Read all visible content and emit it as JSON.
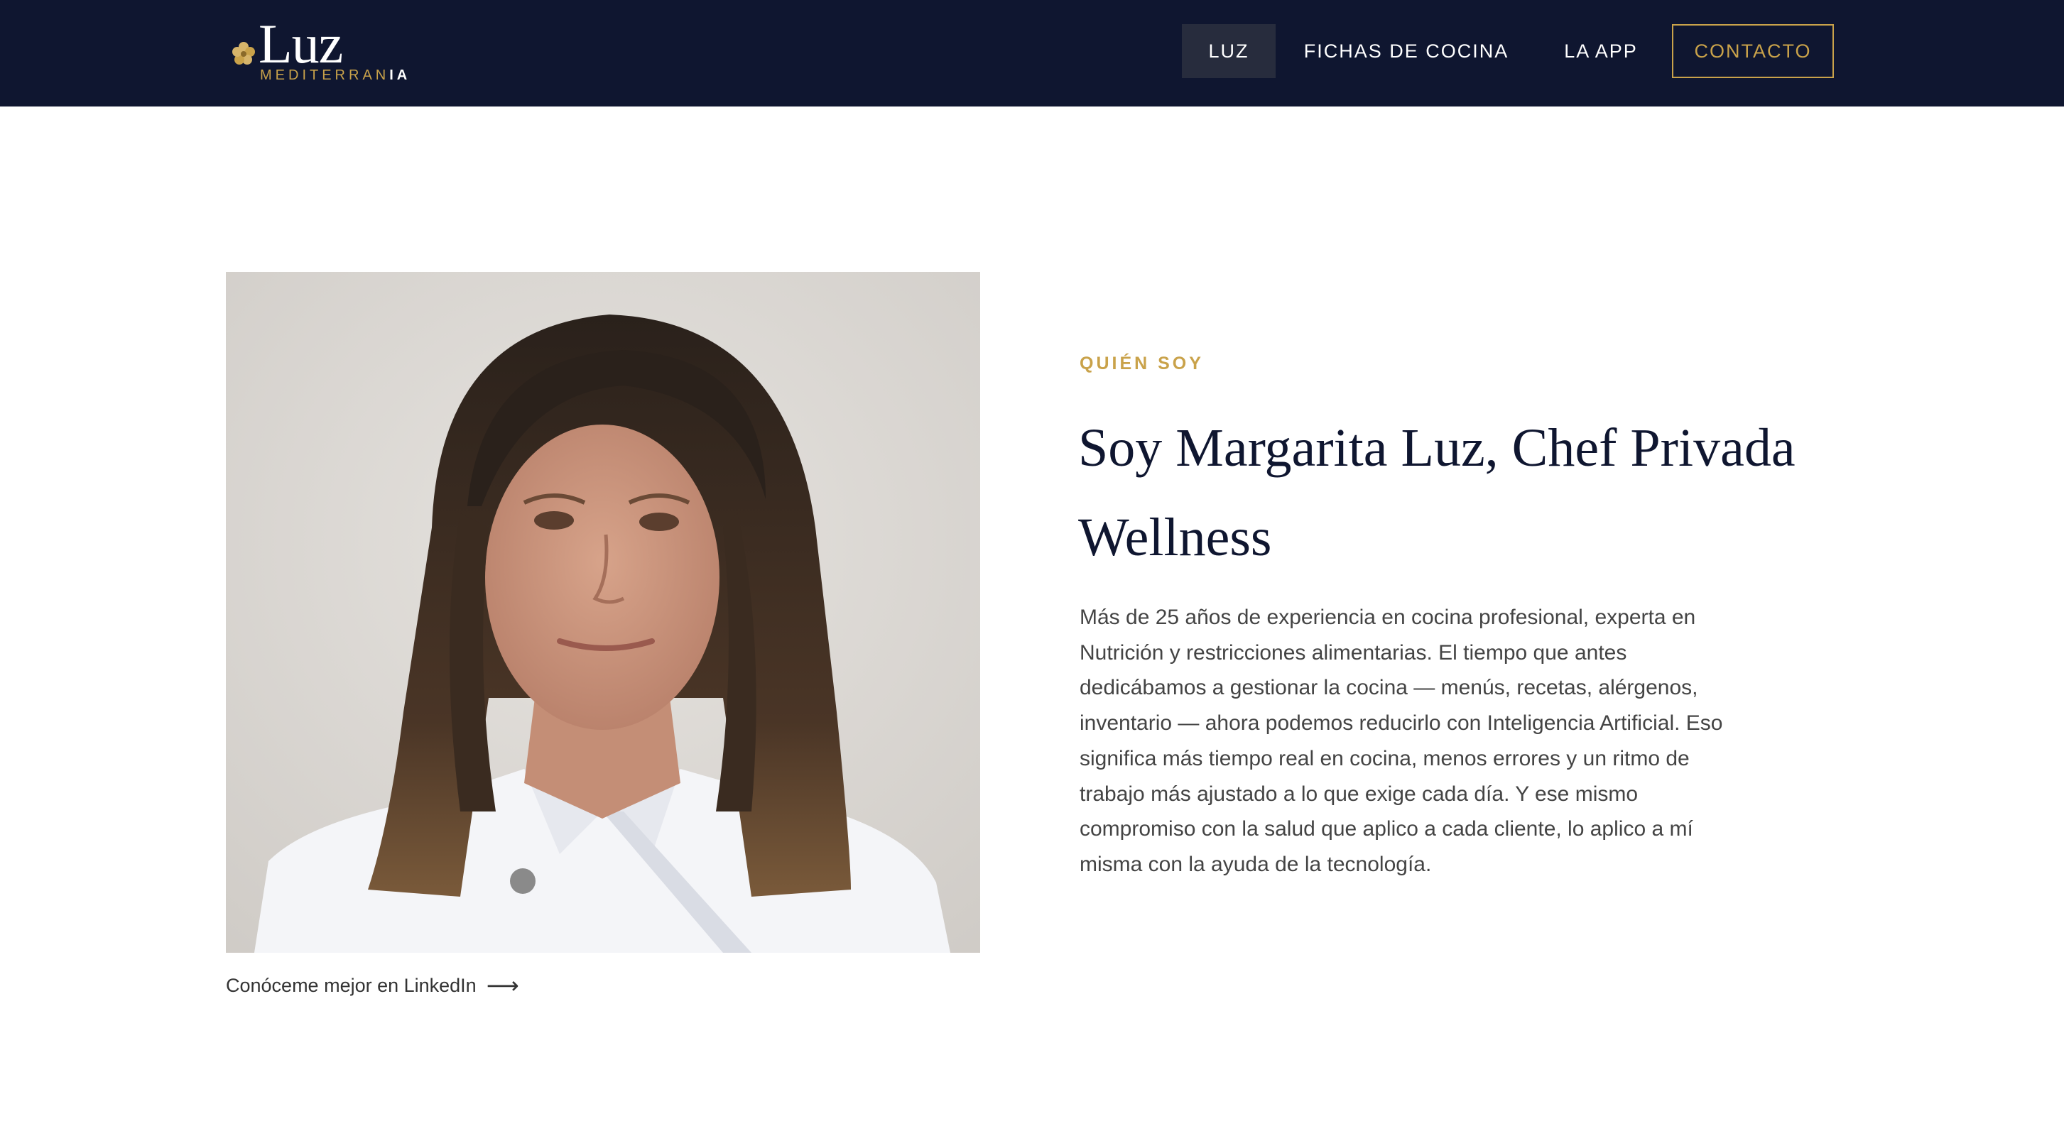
{
  "header": {
    "logo": {
      "word": "Luz",
      "sub_gold": "MEDITERRAN",
      "sub_white": "IA"
    },
    "nav": [
      {
        "label": "LUZ",
        "active": true
      },
      {
        "label": "FICHAS DE COCINA"
      },
      {
        "label": "LA APP"
      },
      {
        "label": "CONTACTO"
      }
    ]
  },
  "about": {
    "eyebrow": "QUIÉN SOY",
    "heading": "Soy Margarita Luz, Chef Privada Wellness",
    "body": "Más de 25 años de experiencia en cocina profesional, experta en Nutrición y restricciones alimentarias. El tiempo que antes dedicábamos a gestionar la cocina — menús, recetas, alérgenos, inventario — ahora podemos reducirlo con Inteligencia Artificial. Eso significa más tiempo real en cocina, menos errores y un ritmo de trabajo más ajustado a lo que exige cada día. Y ese mismo compromiso con la salud que aplico a cada cliente, lo aplico a mí misma con la ayuda de la tecnología.",
    "linkedin_label": "Conóceme mejor en LinkedIn",
    "linkedin_arrow": "⟶"
  },
  "colors": {
    "navy": "#0f1630",
    "gold": "#c9a24a",
    "active_nav_bg": "#272c3d"
  }
}
